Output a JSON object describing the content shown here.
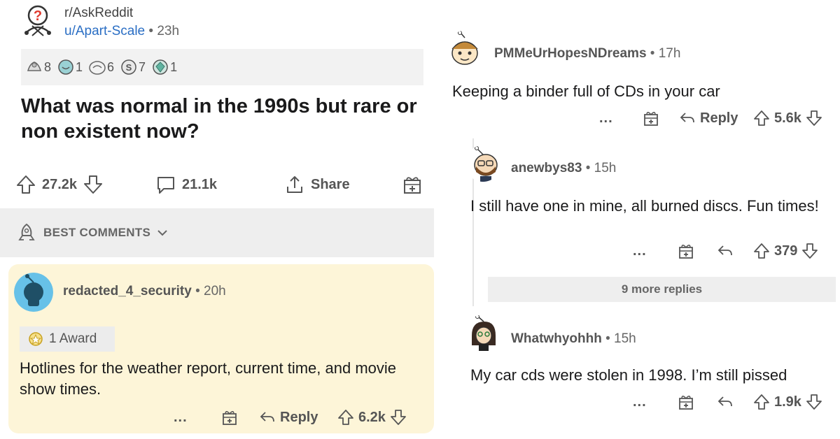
{
  "post": {
    "subreddit": "r/AskReddit",
    "author": "u/Apart-Scale",
    "time": "23h",
    "awards": [
      {
        "icon": "hands-award-icon",
        "count": "8"
      },
      {
        "icon": "wholesome-award-icon",
        "count": "1"
      },
      {
        "icon": "helpful-award-icon",
        "count": "6"
      },
      {
        "icon": "silver-award-icon",
        "count": "7"
      },
      {
        "icon": "gem-award-icon",
        "count": "1"
      }
    ],
    "title": "What was normal in the 1990s but rare or non existent now?",
    "upvotes": "27.2k",
    "comments": "21.1k",
    "share_label": "Share",
    "sort_label": "BEST COMMENTS"
  },
  "comments": [
    {
      "user": "redacted_4_security",
      "time": "20h",
      "award_label": "1 Award",
      "body": "Hotlines for the weather report, current time, and movie show times.",
      "reply_label": "Reply",
      "votes": "6.2k"
    },
    {
      "user": "PMMeUrHopesNDreams",
      "time": "17h",
      "body": "Keeping a binder full of CDs in your car",
      "reply_label": "Reply",
      "votes": "5.6k"
    },
    {
      "user": "anewbys83",
      "time": "15h",
      "body": "I still have one in mine, all burned discs. Fun times!",
      "votes": "379"
    },
    {
      "user": "Whatwhyohhh",
      "time": "15h",
      "body": "My car cds were stolen in 1998. I’m still pissed",
      "votes": "1.9k"
    }
  ],
  "more_replies": "9 more replies",
  "dots": "...",
  "dot_sep": "•",
  "colors": {
    "link": "#2a6ec4",
    "highlight_comment_bg": "#fdf5d8",
    "strip_bg": "#eeeeee"
  }
}
